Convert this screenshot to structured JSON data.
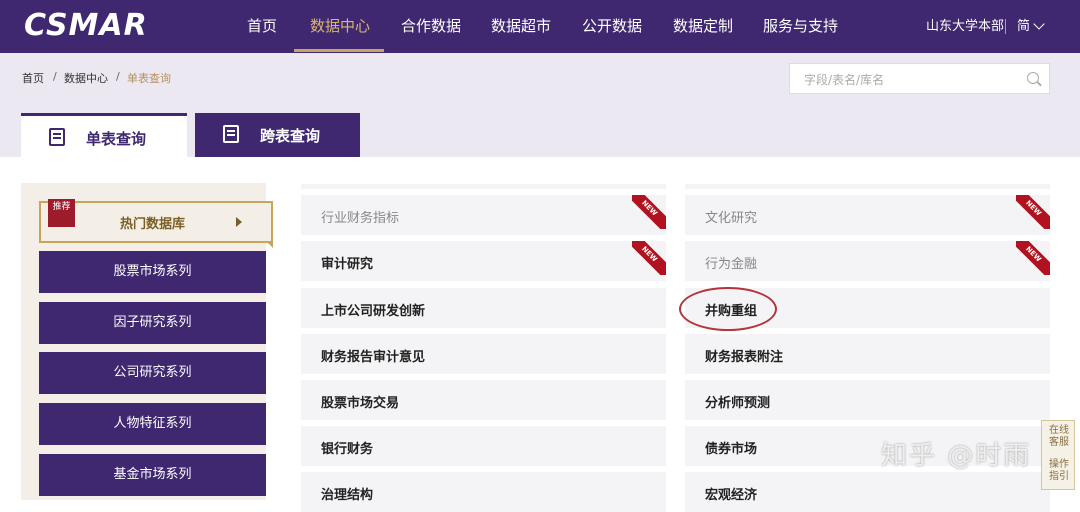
{
  "brand": {
    "logo": "CSMAR"
  },
  "nav": {
    "items": [
      "首页",
      "数据中心",
      "合作数据",
      "数据超市",
      "公开数据",
      "数据定制",
      "服务与支持"
    ],
    "active": "数据中心",
    "account": "山东大学本部",
    "lang": "简"
  },
  "breadcrumb": [
    "首页",
    "数据中心",
    "单表查询"
  ],
  "search": {
    "placeholder": "字段/表名/库名"
  },
  "tabs": [
    {
      "label": "单表查询",
      "active": true
    },
    {
      "label": "跨表查询",
      "active": false
    }
  ],
  "sidebar": {
    "hot": {
      "badge": "推荐",
      "label": "热门数据库"
    },
    "items": [
      "股票市场系列",
      "因子研究系列",
      "公司研究系列",
      "人物特征系列",
      "基金市场系列"
    ]
  },
  "grid": {
    "left": [
      {
        "label": "行业财务指标",
        "new": true,
        "dim": true
      },
      {
        "label": "审计研究",
        "new": true,
        "dim": false
      },
      {
        "label": "上市公司研发创新",
        "new": false,
        "dim": false
      },
      {
        "label": "财务报告审计意见",
        "new": false,
        "dim": false
      },
      {
        "label": "股票市场交易",
        "new": false,
        "dim": false
      },
      {
        "label": "银行财务",
        "new": false,
        "dim": false
      },
      {
        "label": "治理结构",
        "new": false,
        "dim": false
      }
    ],
    "right": [
      {
        "label": "文化研究",
        "new": true,
        "dim": true
      },
      {
        "label": "行为金融",
        "new": true,
        "dim": true
      },
      {
        "label": "并购重组",
        "new": false,
        "dim": false,
        "circled": true
      },
      {
        "label": "财务报表附注",
        "new": false,
        "dim": false
      },
      {
        "label": "分析师预测",
        "new": false,
        "dim": false
      },
      {
        "label": "债券市场",
        "new": false,
        "dim": false
      },
      {
        "label": "宏观经济",
        "new": false,
        "dim": false
      }
    ],
    "new_badge": "NEW"
  },
  "side_tools": [
    "在线客服",
    "操作指引"
  ],
  "watermark": "知乎 @时雨",
  "colors": {
    "primary": "#3f2870",
    "gold": "#c9a45a",
    "new_red": "#b0121f"
  }
}
